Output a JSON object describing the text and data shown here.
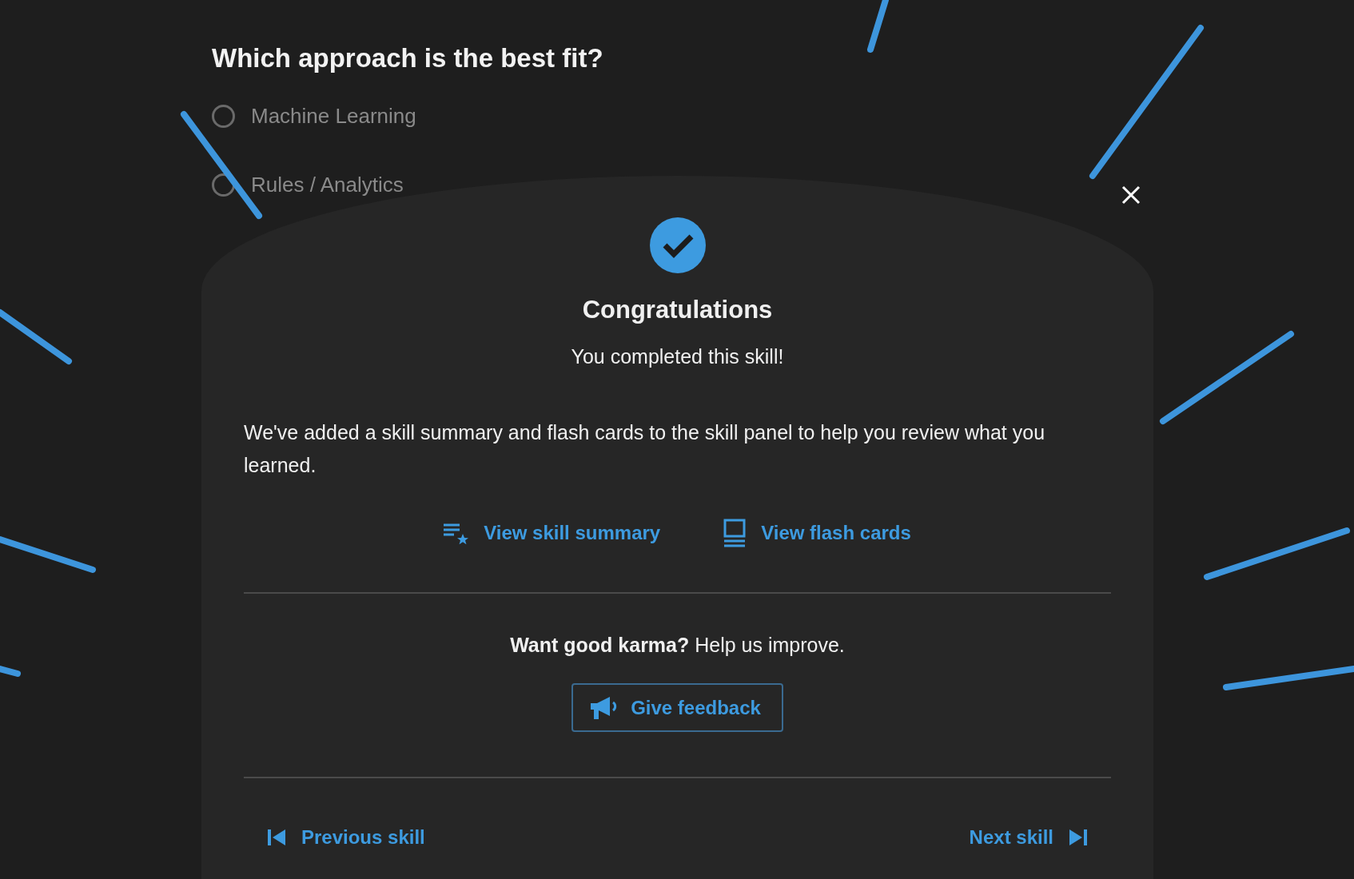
{
  "question": {
    "title": "Which approach is the best fit?",
    "options": [
      {
        "label": "Machine Learning",
        "selected": false
      },
      {
        "label": "Rules / Analytics",
        "selected": false
      }
    ]
  },
  "dialog": {
    "title": "Congratulations",
    "subtitle": "You completed this skill!",
    "message": "We've added a skill summary and flash cards to the skill panel to help you review what you learned.",
    "links": [
      {
        "kind": "summary",
        "label": "View skill summary"
      },
      {
        "kind": "cards",
        "label": "View flash cards"
      }
    ],
    "prompt": "**Want good karma?** Help us improve.",
    "feedback_button": "Give feedback",
    "previous": "Previous skill",
    "next": "Next skill"
  }
}
